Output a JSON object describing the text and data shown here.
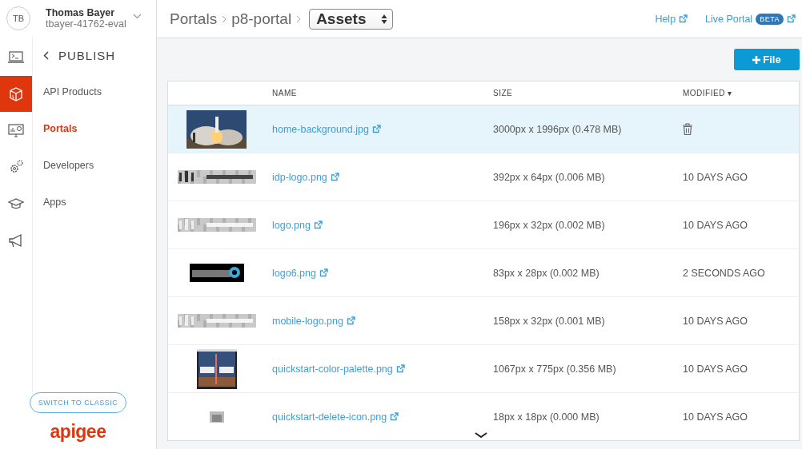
{
  "account": {
    "initials": "TB",
    "name": "Thomas Bayer",
    "org": "tbayer-41762-eval"
  },
  "breadcrumb": {
    "items": [
      "Portals",
      "p8-portal"
    ],
    "page_select": "Assets"
  },
  "header_links": {
    "help": "Help",
    "live_portal": "Live Portal",
    "badge": "BETA"
  },
  "rail": [
    {
      "selected": false
    },
    {
      "selected": true
    },
    {
      "selected": false
    },
    {
      "selected": false
    },
    {
      "selected": false
    },
    {
      "selected": false
    }
  ],
  "nav": {
    "section": "PUBLISH",
    "items": [
      {
        "label": "API Products",
        "selected": false
      },
      {
        "label": "Portals",
        "selected": true
      },
      {
        "label": "Developers",
        "selected": false
      },
      {
        "label": "Apps",
        "selected": false
      }
    ]
  },
  "switch_button": "SWITCH TO CLASSIC",
  "logo": "apigee",
  "add_button": "File",
  "table": {
    "columns": [
      "NAME",
      "SIZE",
      "MODIFIED"
    ],
    "sort_mark": "▾",
    "rows": [
      {
        "name": "home-background.jpg",
        "size": "3000px x 1996px (0.478 MB)",
        "selected": true
      },
      {
        "name": "idp-logo.png",
        "size": "392px x 64px (0.006 MB)",
        "modified": "10 DAYS AGO",
        "selected": false
      },
      {
        "name": "logo.png",
        "size": "196px x 32px (0.002 MB)",
        "modified": "10 DAYS AGO",
        "selected": false
      },
      {
        "name": "logo6.png",
        "size": "83px x 28px (0.002 MB)",
        "modified": "2 SECONDS AGO",
        "selected": false
      },
      {
        "name": "mobile-logo.png",
        "size": "158px x 32px (0.001 MB)",
        "modified": "10 DAYS AGO",
        "selected": false
      },
      {
        "name": "quickstart-color-palette.png",
        "size": "1067px x 775px (0.356 MB)",
        "modified": "10 DAYS AGO",
        "selected": false
      },
      {
        "name": "quickstart-delete-icon.png",
        "size": "18px x 18px (0.000 MB)",
        "modified": "10 DAYS AGO",
        "selected": false
      }
    ]
  }
}
